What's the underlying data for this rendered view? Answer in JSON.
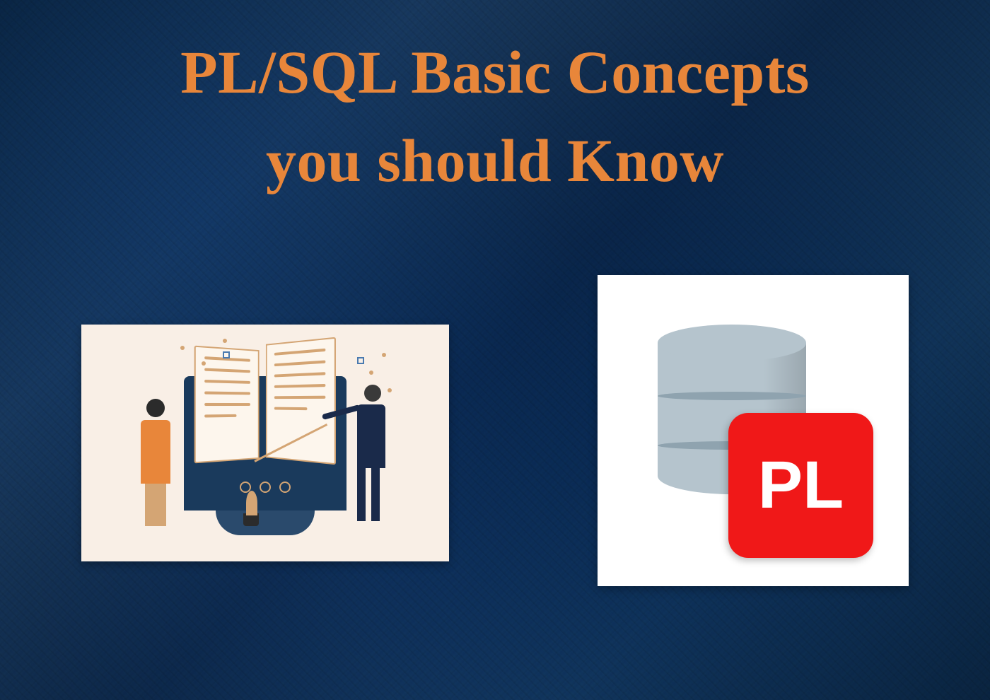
{
  "title": {
    "line1": "PL/SQL Basic Concepts",
    "line2": "you should Know"
  },
  "badge": {
    "label": "PL"
  },
  "colors": {
    "title": "#e8863a",
    "badge_bg": "#f01818",
    "badge_text": "#ffffff",
    "db": "#b5c4cd"
  }
}
